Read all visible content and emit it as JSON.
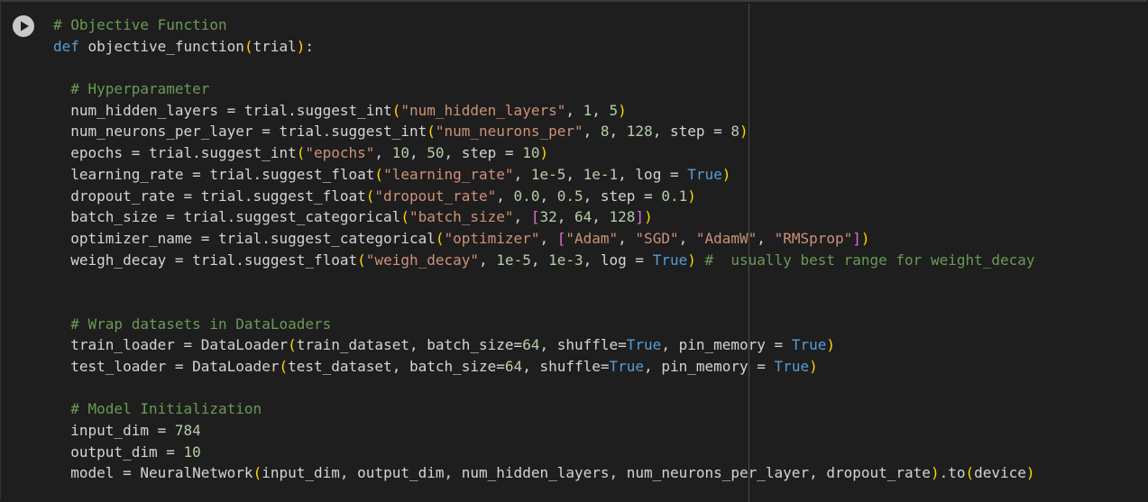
{
  "cell": {
    "run_button_icon": "play-icon",
    "colors": {
      "comment": "#6a9955",
      "keyword": "#569cd6",
      "string": "#ce9178",
      "number": "#b5cea8",
      "paren": "#ffd700",
      "bracket": "#da70d6",
      "text": "#d4d4d4"
    },
    "lines": [
      [
        [
          "# Objective Function",
          "c"
        ]
      ],
      [
        [
          "def",
          "k"
        ],
        [
          " objective_function",
          "t"
        ],
        [
          "(",
          "p"
        ],
        [
          "trial",
          "t"
        ],
        [
          ")",
          "p"
        ],
        [
          ":",
          "t"
        ]
      ],
      [],
      [
        [
          "  # Hyperparameter",
          "c"
        ]
      ],
      [
        [
          "  num_hidden_layers = trial.suggest_int",
          "t"
        ],
        [
          "(",
          "p"
        ],
        [
          "\"num_hidden_layers\"",
          "s"
        ],
        [
          ", ",
          "t"
        ],
        [
          "1",
          "n"
        ],
        [
          ", ",
          "t"
        ],
        [
          "5",
          "n"
        ],
        [
          ")",
          "p"
        ]
      ],
      [
        [
          "  num_neurons_per_layer = trial.suggest_int",
          "t"
        ],
        [
          "(",
          "p"
        ],
        [
          "\"num_neurons_per\"",
          "s"
        ],
        [
          ", ",
          "t"
        ],
        [
          "8",
          "n"
        ],
        [
          ", ",
          "t"
        ],
        [
          "128",
          "n"
        ],
        [
          ", step = ",
          "t"
        ],
        [
          "8",
          "n"
        ],
        [
          ")",
          "p"
        ]
      ],
      [
        [
          "  epochs = trial.suggest_int",
          "t"
        ],
        [
          "(",
          "p"
        ],
        [
          "\"epochs\"",
          "s"
        ],
        [
          ", ",
          "t"
        ],
        [
          "10",
          "n"
        ],
        [
          ", ",
          "t"
        ],
        [
          "50",
          "n"
        ],
        [
          ", step = ",
          "t"
        ],
        [
          "10",
          "n"
        ],
        [
          ")",
          "p"
        ]
      ],
      [
        [
          "  learning_rate = trial.suggest_float",
          "t"
        ],
        [
          "(",
          "p"
        ],
        [
          "\"learning_rate\"",
          "s"
        ],
        [
          ", ",
          "t"
        ],
        [
          "1e-5",
          "n"
        ],
        [
          ", ",
          "t"
        ],
        [
          "1e-1",
          "n"
        ],
        [
          ", log = ",
          "t"
        ],
        [
          "True",
          "bl"
        ],
        [
          ")",
          "p"
        ]
      ],
      [
        [
          "  dropout_rate = trial.suggest_float",
          "t"
        ],
        [
          "(",
          "p"
        ],
        [
          "\"dropout_rate\"",
          "s"
        ],
        [
          ", ",
          "t"
        ],
        [
          "0.0",
          "n"
        ],
        [
          ", ",
          "t"
        ],
        [
          "0.5",
          "n"
        ],
        [
          ", step = ",
          "t"
        ],
        [
          "0.1",
          "n"
        ],
        [
          ")",
          "p"
        ]
      ],
      [
        [
          "  batch_size = trial.suggest_categorical",
          "t"
        ],
        [
          "(",
          "p"
        ],
        [
          "\"batch_size\"",
          "s"
        ],
        [
          ", ",
          "t"
        ],
        [
          "[",
          "b"
        ],
        [
          "32",
          "n"
        ],
        [
          ", ",
          "t"
        ],
        [
          "64",
          "n"
        ],
        [
          ", ",
          "t"
        ],
        [
          "128",
          "n"
        ],
        [
          "]",
          "b"
        ],
        [
          ")",
          "p"
        ]
      ],
      [
        [
          "  optimizer_name = trial.suggest_categorical",
          "t"
        ],
        [
          "(",
          "p"
        ],
        [
          "\"optimizer\"",
          "s"
        ],
        [
          ", ",
          "t"
        ],
        [
          "[",
          "b"
        ],
        [
          "\"Adam\"",
          "s"
        ],
        [
          ", ",
          "t"
        ],
        [
          "\"SGD\"",
          "s"
        ],
        [
          ", ",
          "t"
        ],
        [
          "\"AdamW\"",
          "s"
        ],
        [
          ", ",
          "t"
        ],
        [
          "\"RMSprop\"",
          "s"
        ],
        [
          "]",
          "b"
        ],
        [
          ")",
          "p"
        ]
      ],
      [
        [
          "  weigh_decay = trial.suggest_float",
          "t"
        ],
        [
          "(",
          "p"
        ],
        [
          "\"weigh_decay\"",
          "s"
        ],
        [
          ", ",
          "t"
        ],
        [
          "1e-5",
          "n"
        ],
        [
          ", ",
          "t"
        ],
        [
          "1e-3",
          "n"
        ],
        [
          ", log = ",
          "t"
        ],
        [
          "True",
          "bl"
        ],
        [
          ")",
          "p"
        ],
        [
          " #  usually best range for weight_decay",
          "c"
        ]
      ],
      [],
      [],
      [
        [
          "  # Wrap datasets in DataLoaders",
          "c"
        ]
      ],
      [
        [
          "  train_loader = DataLoader",
          "t"
        ],
        [
          "(",
          "p"
        ],
        [
          "train_dataset, batch_size=",
          "t"
        ],
        [
          "64",
          "n"
        ],
        [
          ", shuffle=",
          "t"
        ],
        [
          "True",
          "bl"
        ],
        [
          ", pin_memory = ",
          "t"
        ],
        [
          "True",
          "bl"
        ],
        [
          ")",
          "p"
        ]
      ],
      [
        [
          "  test_loader = DataLoader",
          "t"
        ],
        [
          "(",
          "p"
        ],
        [
          "test_dataset, batch_size=",
          "t"
        ],
        [
          "64",
          "n"
        ],
        [
          ", shuffle=",
          "t"
        ],
        [
          "True",
          "bl"
        ],
        [
          ", pin_memory = ",
          "t"
        ],
        [
          "True",
          "bl"
        ],
        [
          ")",
          "p"
        ]
      ],
      [],
      [
        [
          "  # Model Initialization",
          "c"
        ]
      ],
      [
        [
          "  input_dim = ",
          "t"
        ],
        [
          "784",
          "n"
        ]
      ],
      [
        [
          "  output_dim = ",
          "t"
        ],
        [
          "10",
          "n"
        ]
      ],
      [
        [
          "  model = NeuralNetwork",
          "t"
        ],
        [
          "(",
          "p"
        ],
        [
          "input_dim, output_dim, num_hidden_layers, num_neurons_per_layer, dropout_rate",
          "t"
        ],
        [
          ")",
          "p"
        ],
        [
          ".to",
          "t"
        ],
        [
          "(",
          "p"
        ],
        [
          "device",
          "t"
        ],
        [
          ")",
          "p"
        ]
      ]
    ]
  }
}
